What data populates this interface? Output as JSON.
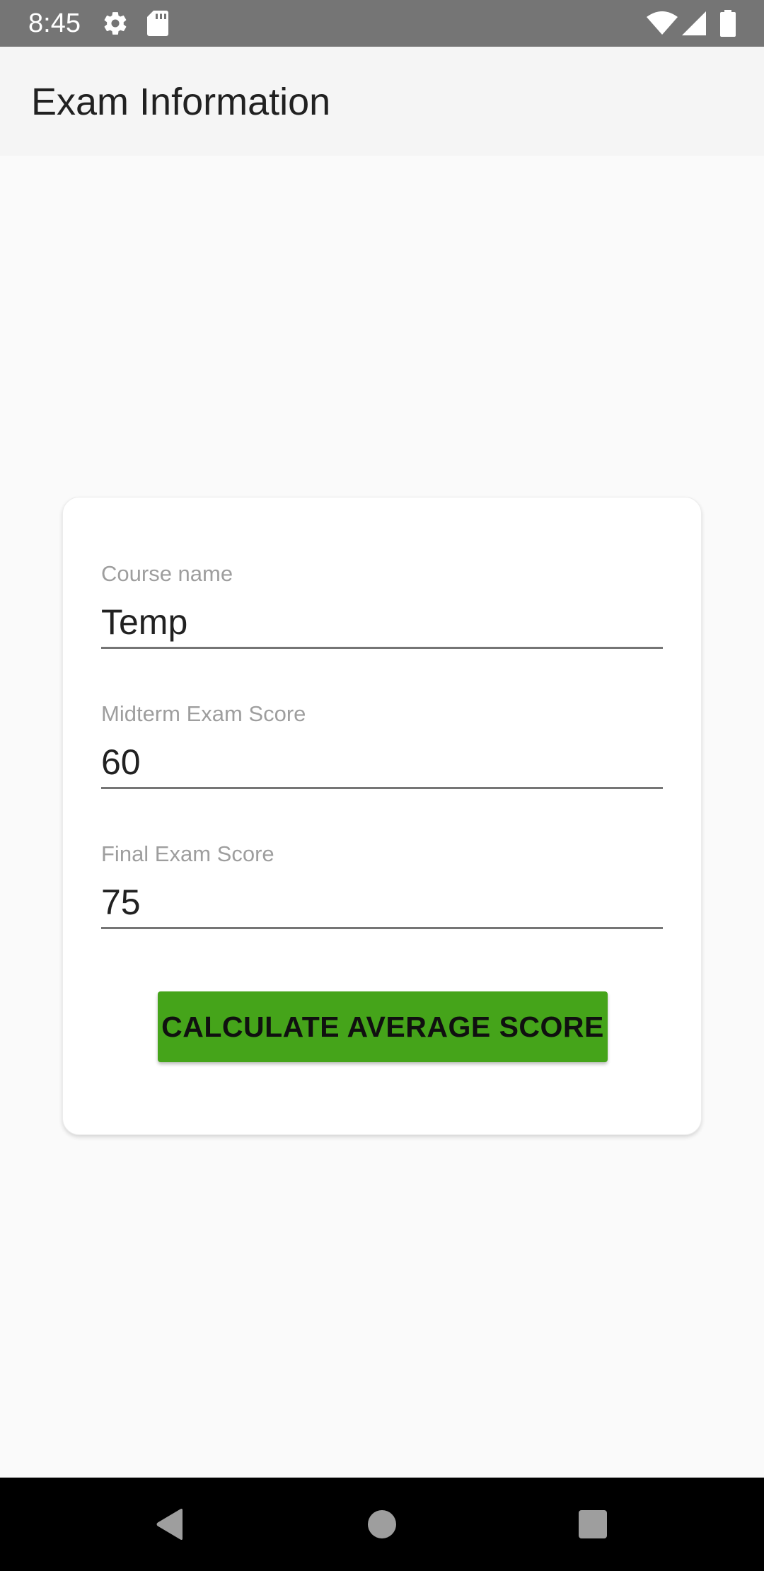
{
  "status_bar": {
    "time": "8:45",
    "icons": [
      "gear-icon",
      "sd-card-icon",
      "wifi-icon",
      "signal-icon",
      "battery-icon"
    ]
  },
  "app_bar": {
    "title": "Exam Information"
  },
  "form": {
    "course_name": {
      "label": "Course name",
      "value": "Temp"
    },
    "midterm_score": {
      "label": "Midterm Exam Score",
      "value": "60"
    },
    "final_score": {
      "label": "Final Exam Score",
      "value": "75"
    },
    "calculate_button_label": "CALCULATE AVERAGE SCORE"
  },
  "colors": {
    "accent_button": "#45a41a",
    "status_bar": "#757575",
    "app_bar": "#f5f5f5",
    "background": "#fafafa"
  },
  "nav_bar": {
    "icons": [
      "back-icon",
      "home-icon",
      "recents-icon"
    ]
  }
}
